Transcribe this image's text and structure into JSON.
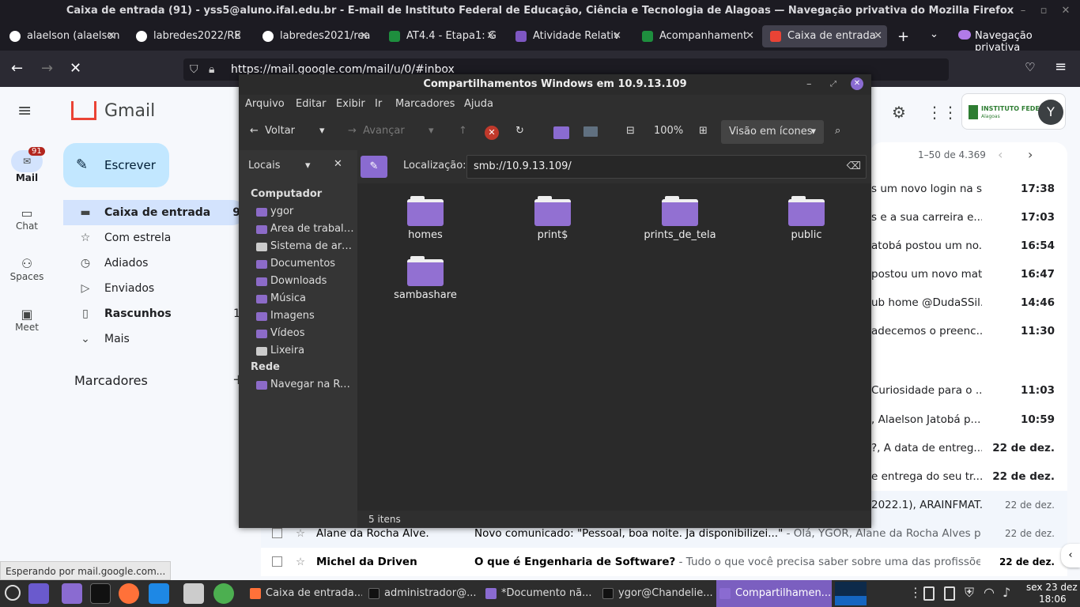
{
  "window_title": "Caixa de entrada (91) - yss5@aluno.ifal.edu.br - E-mail de Instituto Federal de Educação, Ciência e Tecnologia de Alagoas — Navegação privativa do Mozilla Firefox",
  "tabs": [
    {
      "label": "alaelson (alaelson",
      "favicon_color": "#ffffff"
    },
    {
      "label": "labredes2022/RE",
      "favicon_color": "#ffffff"
    },
    {
      "label": "labredes2021/rea",
      "favicon_color": "#ffffff"
    },
    {
      "label": "AT4.4 - Etapa1: G",
      "favicon_color": "#1e8e3e"
    },
    {
      "label": "Atividade Relativ",
      "favicon_color": "#7e57c2"
    },
    {
      "label": "Acompanhament",
      "favicon_color": "#1e8e3e"
    },
    {
      "label": "Caixa de entrada",
      "favicon_color": "#ea4335"
    }
  ],
  "private_label": "Navegação privativa",
  "url": "https://mail.google.com/mail/u/0/#inbox",
  "gmail": {
    "brand": "Gmail",
    "compose": "Escrever",
    "rail": [
      {
        "label": "Mail",
        "badge": "91"
      },
      {
        "label": "Chat"
      },
      {
        "label": "Spaces"
      },
      {
        "label": "Meet"
      }
    ],
    "nav": [
      {
        "label": "Caixa de entrada",
        "count": "9"
      },
      {
        "label": "Com estrela"
      },
      {
        "label": "Adiados"
      },
      {
        "label": "Enviados"
      },
      {
        "label": "Rascunhos",
        "count": "1"
      },
      {
        "label": "Mais"
      }
    ],
    "labels_header": "Marcadores",
    "pagination": "1–50 de 4.369",
    "org_logo": "INSTITUTO FEDERAL",
    "org_sub": "Alagoas",
    "avatar": "Y",
    "rows": [
      {
        "snippet": "s um novo login na s...",
        "time": "17:38",
        "read": false
      },
      {
        "snippet": "s e a sua carreira e...",
        "time": "17:03",
        "read": false
      },
      {
        "snippet": "atobá postou um no...",
        "time": "16:54",
        "read": false
      },
      {
        "snippet": "postou um novo mat...",
        "time": "16:47",
        "read": false
      },
      {
        "snippet": "ub home @DudaSSil...",
        "time": "14:46",
        "read": false
      },
      {
        "snippet": "adecemos o preenc...",
        "time": "11:30",
        "read": false
      },
      {
        "snippet": "Curiosidade para o ...",
        "time": "11:03",
        "read": false
      },
      {
        "snippet": ", Alaelson Jatobá p...",
        "time": "10:59",
        "read": false
      },
      {
        "snippet": "?, A data de entreg...",
        "time": "22 de dez.",
        "read": false
      },
      {
        "snippet": "e entrega do seu tr...",
        "time": "22 de dez.",
        "read": false
      },
      {
        "snippet": "2022.1), ARAINFMAT...",
        "time": "22 de dez.",
        "read": true
      }
    ],
    "bottom_rows": [
      {
        "sender": "Alane da Rocha Alve.",
        "subject": "Novo comunicado: \"Pessoal, boa noite. Ja disponibilizei...\"",
        "preview": " - Olá, YGOR, Alane da Rocha Alves post...",
        "time": "22 de dez."
      },
      {
        "sender": "Michel da Driven",
        "subject": "O que é Engenharia de Software?",
        "preview": " - Tudo o que você precisa saber sobre uma das profissões ma...",
        "time": "22 de dez."
      }
    ],
    "status": "Esperando por mail.google.com..."
  },
  "nemo": {
    "title": "Compartilhamentos Windows em 10.9.13.109",
    "menu": [
      "Arquivo",
      "Editar",
      "Exibir",
      "Ir",
      "Marcadores",
      "Ajuda"
    ],
    "back": "Voltar",
    "forward": "Avançar",
    "zoom": "100%",
    "view_mode": "Visão em ícones",
    "side_mode": "Locais",
    "location_label": "Localização:",
    "location": "smb://10.9.13.109/",
    "computer_header": "Computador",
    "places": [
      "ygor",
      "Área de trabalho",
      "Sistema de arq...",
      "Documentos",
      "Downloads",
      "Música",
      "Imagens",
      "Vídeos",
      "Lixeira"
    ],
    "network_header": "Rede",
    "network": [
      "Navegar na Rede"
    ],
    "files": [
      "homes",
      "print$",
      "prints_de_tela",
      "public",
      "sambashare"
    ],
    "status": "5 itens"
  },
  "taskbar": {
    "tasks": [
      "Caixa de entrada...",
      "administrador@...",
      "*Documento nã...",
      "ygor@Chandelie...",
      "Compartilhamen..."
    ],
    "date": "sex 23 dez",
    "time": "18:06"
  }
}
